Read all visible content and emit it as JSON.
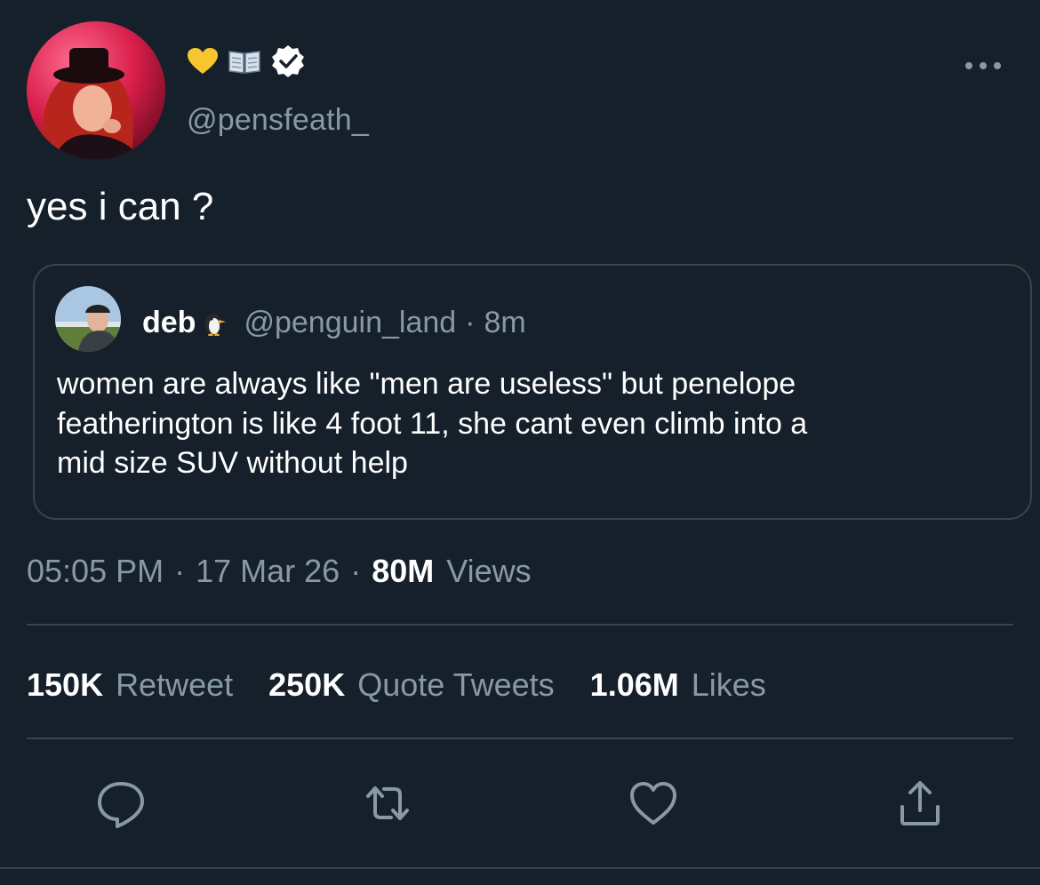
{
  "author": {
    "name_emojis": [
      "yellow-heart",
      "open-book"
    ],
    "verified": true,
    "handle": "@pensfeath_"
  },
  "tweet": {
    "text": "yes i can ?"
  },
  "quoted": {
    "name": "deb",
    "name_emoji": "penguin",
    "handle": "@penguin_land",
    "separator": "·",
    "time": "8m",
    "text_lines": [
      "women are always like \"men are useless\" but penelope",
      "featherington is like 4 foot 11, she cant even climb into a",
      "mid size SUV without help"
    ]
  },
  "meta": {
    "time": "05:05 PM",
    "separator": "·",
    "date": "17 Mar 26",
    "views_count": "80M",
    "views_label": "Views"
  },
  "stats": {
    "retweets": {
      "count": "150K",
      "label": "Retweet"
    },
    "quotes": {
      "count": "250K",
      "label": "Quote Tweets"
    },
    "likes": {
      "count": "1.06M",
      "label": "Likes"
    }
  },
  "actions": [
    "reply-icon",
    "retweet-icon",
    "like-icon",
    "share-icon"
  ],
  "colors": {
    "background": "#15202b",
    "text": "#ffffff",
    "secondary": "#8899a6",
    "border": "#38444d"
  }
}
